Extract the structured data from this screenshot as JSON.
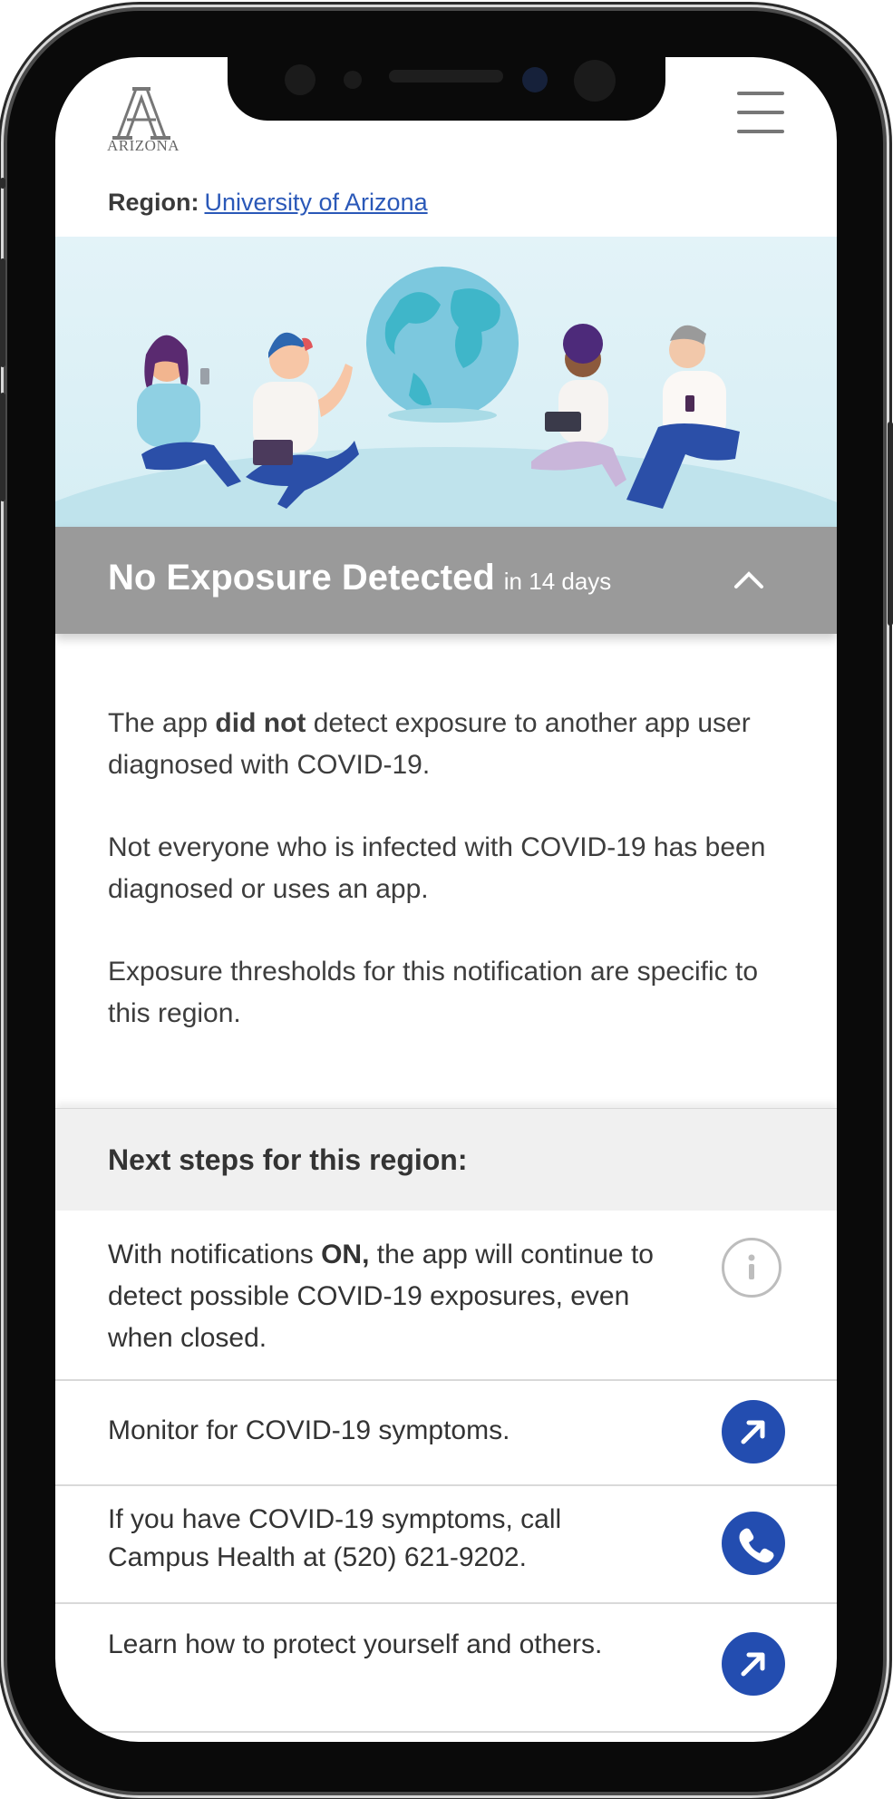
{
  "header": {
    "logo_text": "ARIZONA",
    "menu_label": "menu"
  },
  "region": {
    "label": "Region:",
    "value": "University of Arizona"
  },
  "status": {
    "title": "No Exposure Detected",
    "subtitle": "in 14 days"
  },
  "message": {
    "p1_pre": "The app ",
    "p1_bold": "did not",
    "p1_post": " detect exposure to another app user diagnosed with COVID-19.",
    "p2": "Not everyone who is infected with COVID-19 has been diagnosed or uses an app.",
    "p3": "Exposure thresholds for this notification are specific to this region."
  },
  "next_steps": {
    "title": "Next steps for this region:",
    "items": [
      {
        "pre": "With notifications ",
        "bold": "ON,",
        "post": " the app will continue to detect possible COVID-19 exposures, even when closed.",
        "icon": "info-icon"
      },
      {
        "text": "Monitor for COVID-19 symptoms.",
        "icon": "external-link-icon"
      },
      {
        "text": "If you have COVID-19 symptoms, call Campus Health at (520) 621-9202.",
        "icon": "phone-icon"
      },
      {
        "text": "Learn how to protect yourself and others.",
        "icon": "external-link-icon"
      }
    ]
  },
  "colors": {
    "accent": "#234db0",
    "link": "#2a58b8",
    "status_bar": "#9a9a9a",
    "hero_bg": "#e3f3f8"
  }
}
